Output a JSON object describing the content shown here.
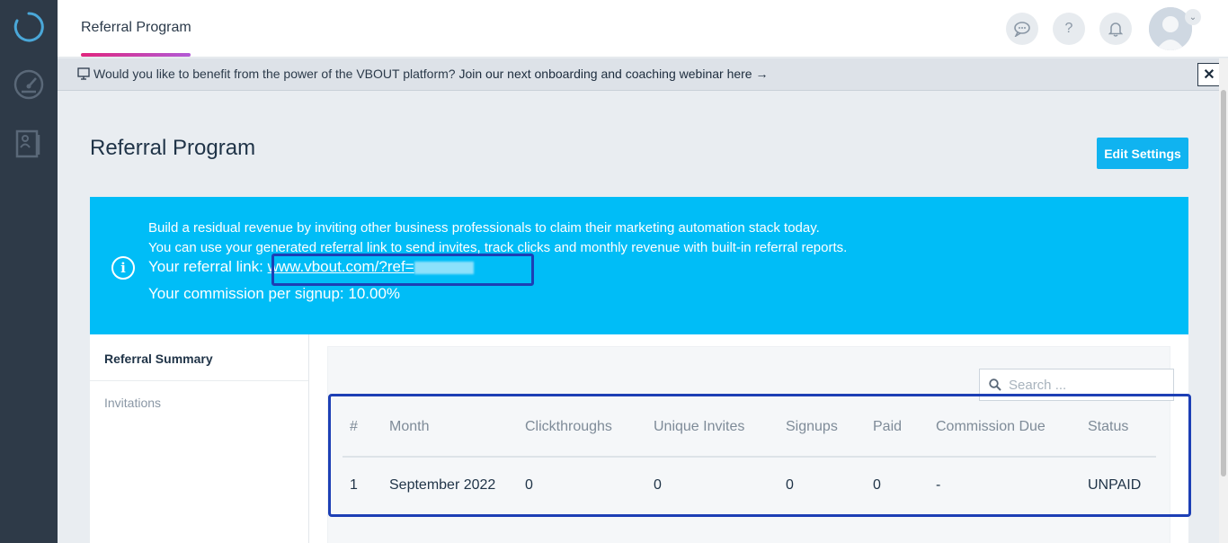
{
  "header": {
    "tab_label": "Referral Program"
  },
  "announcement": {
    "text": "Would you like to benefit from the power of the VBOUT platform?",
    "link": "Join our next onboarding and coaching webinar here →",
    "close": "✕"
  },
  "page": {
    "title": "Referral Program",
    "edit_button": "Edit Settings"
  },
  "banner": {
    "line1": "Build a residual revenue by inviting other business professionals to claim their marketing automation stack today.",
    "line2": "You can use your generated referral link to send invites, track clicks and monthly revenue with built-in referral reports.",
    "link_label": "Your referral link:",
    "link_value": "www.vbout.com/?ref=",
    "commission": "Your commission per signup: 10.00%"
  },
  "side_tabs": {
    "summary": "Referral Summary",
    "invitations": "Invitations"
  },
  "search": {
    "placeholder": "Search ..."
  },
  "table": {
    "columns": [
      "#",
      "Month",
      "Clickthroughs",
      "Unique Invites",
      "Signups",
      "Paid",
      "Commission Due",
      "Status"
    ],
    "rows": [
      [
        "1",
        "September 2022",
        "0",
        "0",
        "0",
        "0",
        "-",
        "UNPAID"
      ]
    ]
  },
  "colors": {
    "sidebar": "#2e3a48",
    "banner": "#00bdf7",
    "accent_button": "#10b3f0",
    "highlight_box": "#1d3fb5"
  },
  "icons": [
    "spinner-logo-icon",
    "dashboard-gauge-icon",
    "contacts-doc-icon",
    "chat-icon",
    "help-icon",
    "bell-icon",
    "user-avatar-icon",
    "monitor-icon",
    "info-icon",
    "search-icon"
  ]
}
